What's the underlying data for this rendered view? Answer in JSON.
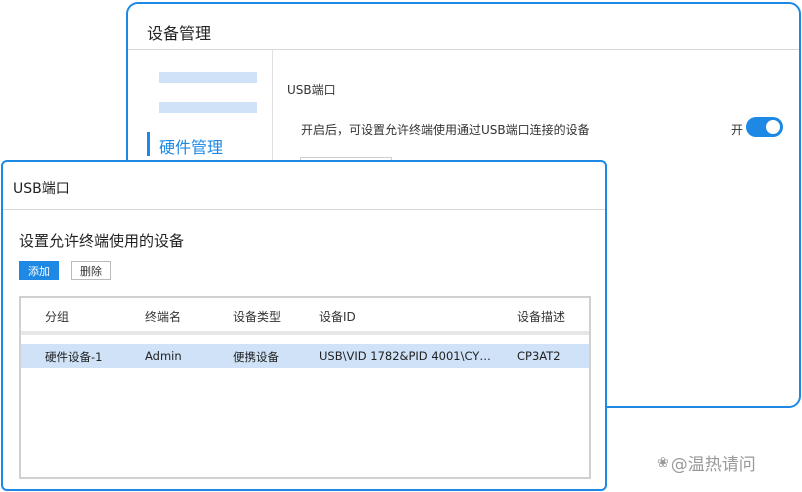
{
  "back_window": {
    "title": "设备管理",
    "nav_active": "硬件管理",
    "section_label": "USB端口",
    "setting_description": "开启后，可设置允许终端使用通过USB端口连接的设备",
    "toggle_text": "开",
    "toggle_on": true
  },
  "dialog": {
    "title": "USB端口",
    "heading": "设置允许终端使用的设备",
    "add_button": "添加",
    "delete_button": "删除",
    "table": {
      "columns": [
        "分组",
        "终端名",
        "设备类型",
        "设备ID",
        "设备描述"
      ],
      "rows": [
        [
          "硬件设备-1",
          "Admin",
          "便携设备",
          "USB\\VID 1782&PID 4001\\CY1...",
          "CP3AT2"
        ]
      ]
    }
  },
  "watermark": {
    "text": "@温热请问"
  },
  "colors": {
    "accent": "#1e88e5",
    "row_highlight": "#cfe2f8"
  }
}
